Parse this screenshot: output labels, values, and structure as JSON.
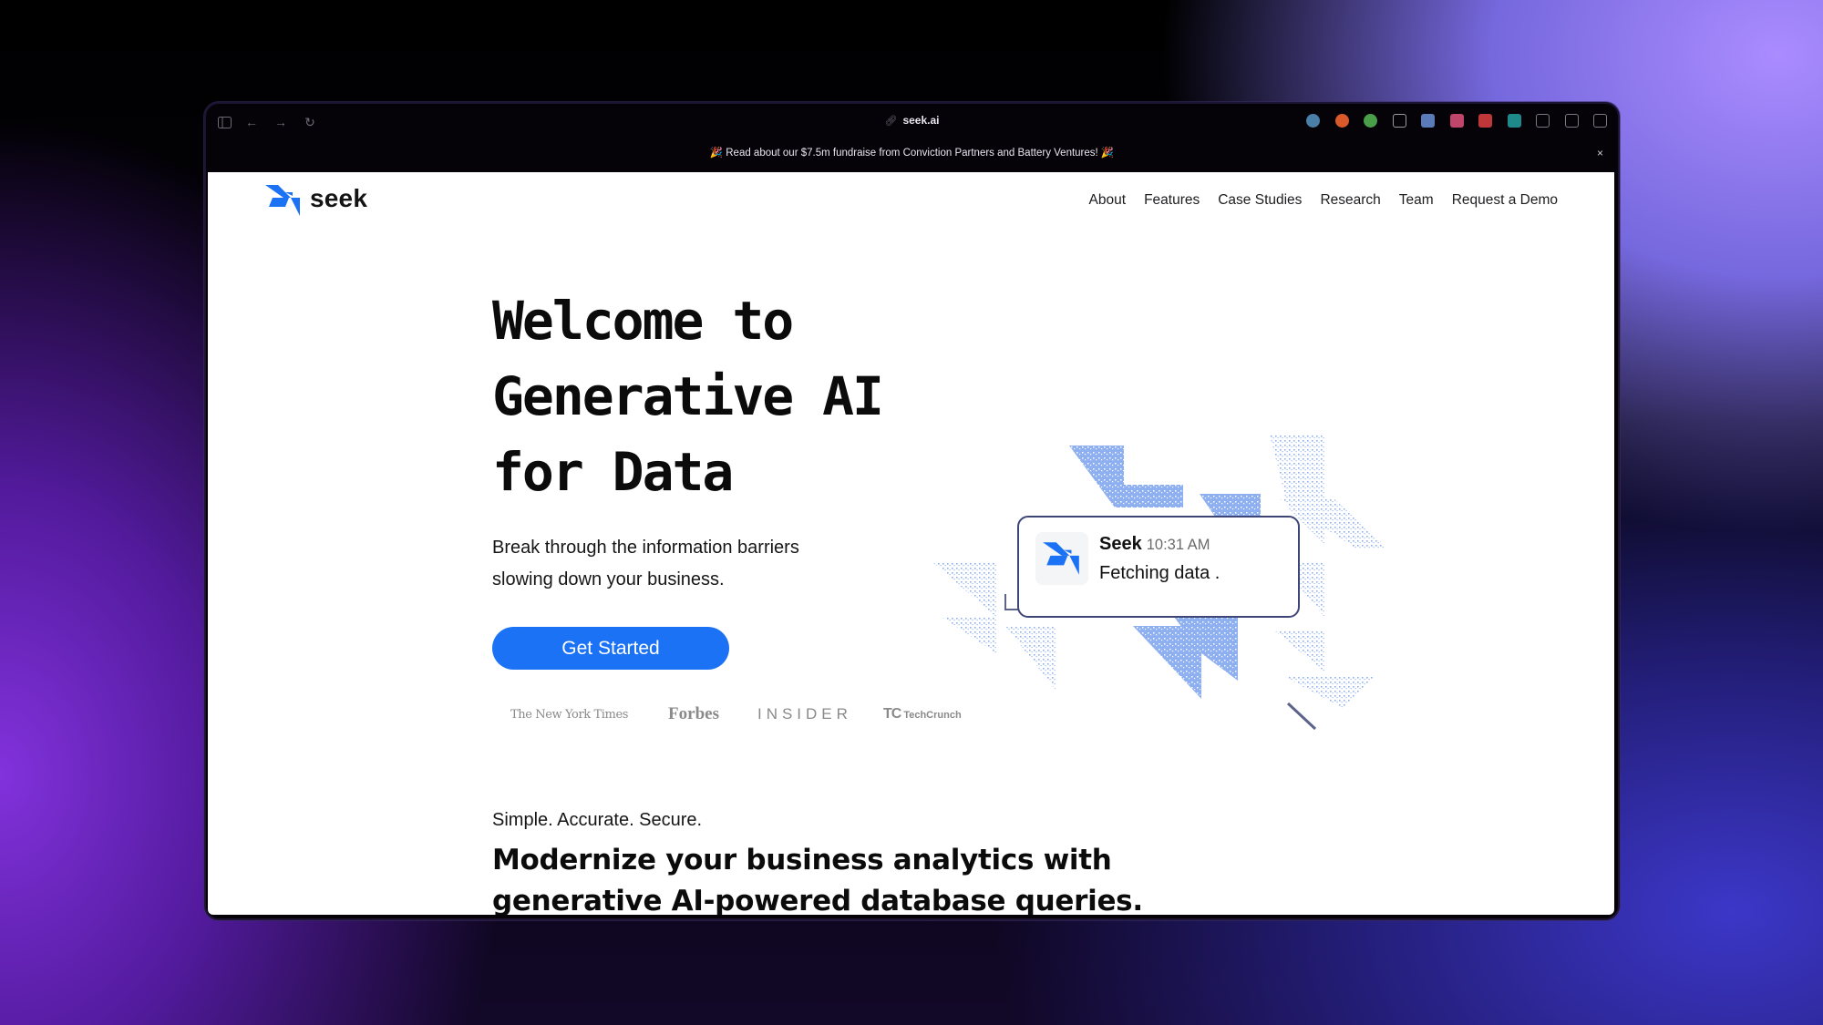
{
  "browser": {
    "url": "seek.ai",
    "nav_icons": [
      "sidebar-toggle-icon",
      "back-arrow-icon",
      "forward-arrow-icon",
      "reload-icon"
    ],
    "extensions": [
      {
        "name": "extension-1password-icon",
        "color": "#4a7fa8"
      },
      {
        "name": "extension-plus-icon",
        "color": "#d9592a"
      },
      {
        "name": "extension-chrome-color-icon",
        "color": "#4a9e4a"
      },
      {
        "name": "extension-notion-icon",
        "color": "#9a9a9a"
      },
      {
        "name": "extension-chart-icon",
        "color": "#5a7ab8"
      },
      {
        "name": "extension-translate-icon",
        "color": "#c0456a"
      },
      {
        "name": "extension-checklist-icon",
        "color": "#c0373a"
      },
      {
        "name": "extension-atom-icon",
        "color": "#1f8a8a"
      },
      {
        "name": "extension-font-icon",
        "color": "#7a7880"
      },
      {
        "name": "extension-settings-icon",
        "color": "#7a7880"
      },
      {
        "name": "split-view-icon",
        "color": "#7a7880"
      }
    ]
  },
  "banner": {
    "text": "🎉 Read about our $7.5m fundraise from Conviction Partners and Battery Ventures! 🎉",
    "close": "×"
  },
  "header": {
    "brand": "seek",
    "brand_color": "#1b72f5",
    "nav": [
      "About",
      "Features",
      "Case Studies",
      "Research",
      "Team",
      "Request a Demo"
    ]
  },
  "hero": {
    "title_lines": [
      "Welcome to",
      "Generative AI",
      "for Data"
    ],
    "subtitle_lines": [
      "Break through the information barriers",
      "slowing down your business."
    ],
    "cta": "Get Started",
    "cta_color": "#1b72f5",
    "press": {
      "nyt": "The New York Times",
      "forbes": "Forbes",
      "insider": "INSIDER",
      "techcrunch_mark": "TC",
      "techcrunch": "TechCrunch"
    }
  },
  "illustration": {
    "sender": "Seek",
    "time": "10:31 AM",
    "message": "Fetching data .",
    "accent": "#8fb0f0"
  },
  "section": {
    "kicker": "Simple. Accurate. Secure.",
    "title_lines": [
      "Modernize your business analytics with",
      "generative AI-powered database queries."
    ]
  }
}
